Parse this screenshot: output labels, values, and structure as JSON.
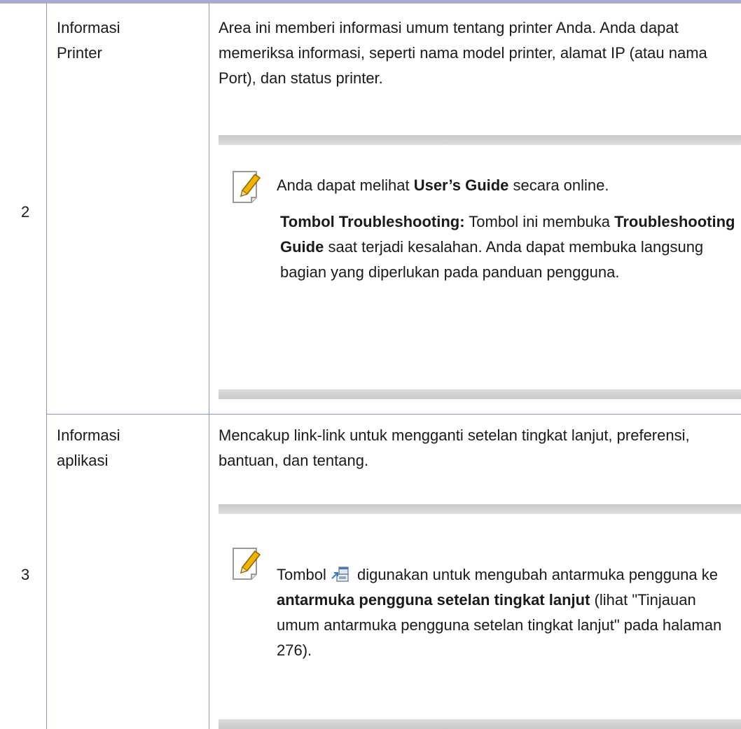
{
  "rows": [
    {
      "number": "2",
      "label_line1": "Informasi",
      "label_line2": "Printer",
      "description": "Area ini memberi informasi umum tentang printer Anda. Anda dapat memeriksa informasi, seperti nama model printer, alamat IP (atau nama Port), dan status printer.",
      "note": {
        "p1_a": "Anda dapat melihat ",
        "p1_b": "User’s Guide",
        "p1_c": " secara online.",
        "p2_a": "Tombol Troubleshooting:",
        "p2_b": " Tombol ini membuka ",
        "p2_c": "Troubleshooting Guide",
        "p2_d": " saat terjadi kesalahan. Anda dapat membuka langsung bagian yang diperlukan pada panduan pengguna."
      }
    },
    {
      "number": "3",
      "label_line1": "Informasi",
      "label_line2": "aplikasi",
      "description": "Mencakup link-link untuk mengganti setelan tingkat lanjut, preferensi, bantuan, dan tentang.",
      "note": {
        "a": "Tombol",
        "b": " digunakan untuk mengubah antarmuka pengguna ke ",
        "c": "antarmuka pengguna setelan tingkat lanjut",
        "d": " (lihat \"Tinjauan umum antarmuka pengguna setelan tingkat lanjut\" pada halaman 276)."
      }
    }
  ],
  "icons": {
    "note": "note-pencil-icon",
    "advanced_ui_button": "advanced-ui-switch-icon"
  },
  "colors": {
    "rule": "#8f93c4",
    "top_bar": "#a9acd1",
    "note_band": "#cccccc",
    "pencil": "#f2b200"
  }
}
